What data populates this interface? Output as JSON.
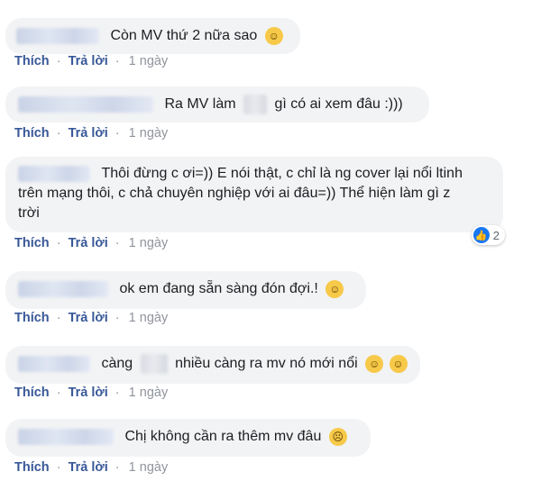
{
  "actions": {
    "like": "Thích",
    "reply": "Trả lời",
    "sep": "·"
  },
  "comments": [
    {
      "text": "Còn MV thứ 2 nữa sao",
      "emoji": "grinning-face-icon",
      "time": "1 ngày"
    },
    {
      "text_before": "Ra MV làm",
      "text_after": "gì có ai xem đâu :)))",
      "time": "1 ngày"
    },
    {
      "line1": "Thôi đừng c ơi=)) E nói thật, c chỉ là ng cover lại nổi ltinh",
      "line2": "trên mạng thôi, c chả chuyên nghiệp với ai đâu=)) Thể hiện làm gì z",
      "line3": "trời",
      "time": "1 ngày",
      "reaction_count": "2"
    },
    {
      "text": "ok em đang sẵn sàng đón đợi.!",
      "emoji": "grinning-smile-icon",
      "time": "1 ngày"
    },
    {
      "text_before": "càng",
      "text_after": "nhiều càng ra mv nó mới nổi",
      "emoji": "rolling-laughing-icon",
      "time": "1 ngày"
    },
    {
      "text": "Chị không cần ra thêm mv đâu",
      "emoji": "disappointed-face-icon",
      "time": "1 ngày"
    }
  ]
}
